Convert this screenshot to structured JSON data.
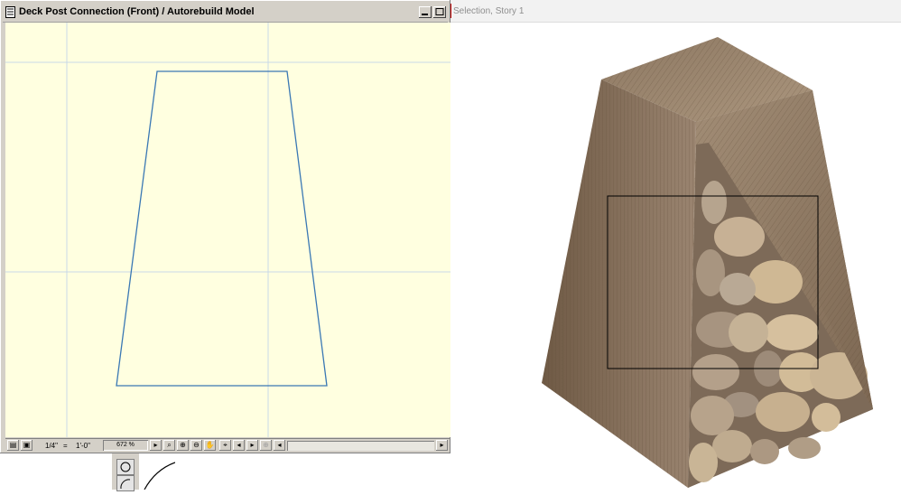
{
  "window_2d": {
    "title": "Deck Post Connection (Front) / Autorebuild Model",
    "status": {
      "scale_label": "1/4\"",
      "equals": "=",
      "scale_value": "1'-0\"",
      "zoom": "672 %"
    }
  },
  "window_3d": {
    "title": "Selection, Story 1"
  },
  "colors": {
    "canvas_bg": "#ffffe0",
    "outline": "#3a78b4",
    "gridline": "#c8d8e8",
    "chrome": "#d4d0c8"
  },
  "icons": {
    "titlebar": [
      "doc-icon",
      "minimize-icon",
      "maximize-icon"
    ],
    "statusbar": [
      "layers-icon",
      "view-icon",
      "zoom-in-icon",
      "zoom-out-icon",
      "pan-icon",
      "fit-icon",
      "prev-zoom-icon",
      "next-zoom-icon",
      "scroll-left-icon",
      "scroll-right-icon"
    ],
    "toolbox": [
      "circle-tool-icon",
      "arc-tool-icon"
    ]
  }
}
